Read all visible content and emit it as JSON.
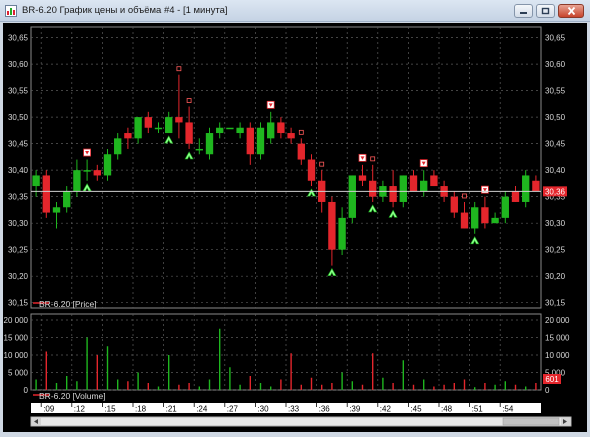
{
  "window": {
    "title": "BR-6.20 График цены и объёма #4 - [1 минута]",
    "minimize_icon": "minimize-icon",
    "maximize_icon": "maximize-icon",
    "close_icon": "close-icon"
  },
  "colors": {
    "background": "#000000",
    "bull": "#1fb61f",
    "bear": "#e4262c",
    "grid": "#5a5a5a",
    "axis_text": "#d8d8d8",
    "current_price_line": "#d0d0d0",
    "current_price_badge": "#e4262c"
  },
  "chart_data": [
    {
      "type": "candlestick",
      "legend": "BR-6.20 [Price]",
      "ylim": [
        30.14,
        30.67
      ],
      "y_ticks": [
        "30,15",
        "30,20",
        "30,25",
        "30,30",
        "30,35",
        "30,40",
        "30,45",
        "30,50",
        "30,55",
        "30,60",
        "30,65"
      ],
      "current_price_label": "30,36",
      "current_price": 30.36,
      "grid": "dashed",
      "candles": [
        {
          "o": 30.37,
          "h": 30.4,
          "l": 30.35,
          "c": 30.39
        },
        {
          "o": 30.39,
          "h": 30.4,
          "l": 30.31,
          "c": 30.32
        },
        {
          "o": 30.32,
          "h": 30.34,
          "l": 30.29,
          "c": 30.33
        },
        {
          "o": 30.33,
          "h": 30.37,
          "l": 30.32,
          "c": 30.36
        },
        {
          "o": 30.36,
          "h": 30.42,
          "l": 30.35,
          "c": 30.4
        },
        {
          "o": 30.4,
          "h": 30.42,
          "l": 30.38,
          "c": 30.4
        },
        {
          "o": 30.4,
          "h": 30.41,
          "l": 30.38,
          "c": 30.39
        },
        {
          "o": 30.39,
          "h": 30.44,
          "l": 30.38,
          "c": 30.43
        },
        {
          "o": 30.43,
          "h": 30.47,
          "l": 30.42,
          "c": 30.46
        },
        {
          "o": 30.47,
          "h": 30.48,
          "l": 30.44,
          "c": 30.46
        },
        {
          "o": 30.46,
          "h": 30.5,
          "l": 30.45,
          "c": 30.5
        },
        {
          "o": 30.5,
          "h": 30.51,
          "l": 30.47,
          "c": 30.48
        },
        {
          "o": 30.48,
          "h": 30.49,
          "l": 30.47,
          "c": 30.48
        },
        {
          "o": 30.47,
          "h": 30.51,
          "l": 30.47,
          "c": 30.5
        },
        {
          "o": 30.5,
          "h": 30.58,
          "l": 30.46,
          "c": 30.49
        },
        {
          "o": 30.49,
          "h": 30.52,
          "l": 30.44,
          "c": 30.45
        },
        {
          "o": 30.44,
          "h": 30.46,
          "l": 30.43,
          "c": 30.44
        },
        {
          "o": 30.43,
          "h": 30.48,
          "l": 30.42,
          "c": 30.47
        },
        {
          "o": 30.47,
          "h": 30.49,
          "l": 30.46,
          "c": 30.48
        },
        {
          "o": 30.48,
          "h": 30.48,
          "l": 30.48,
          "c": 30.48
        },
        {
          "o": 30.47,
          "h": 30.49,
          "l": 30.46,
          "c": 30.48
        },
        {
          "o": 30.48,
          "h": 30.49,
          "l": 30.41,
          "c": 30.43
        },
        {
          "o": 30.43,
          "h": 30.49,
          "l": 30.42,
          "c": 30.48
        },
        {
          "o": 30.46,
          "h": 30.51,
          "l": 30.45,
          "c": 30.49
        },
        {
          "o": 30.49,
          "h": 30.5,
          "l": 30.46,
          "c": 30.47
        },
        {
          "o": 30.47,
          "h": 30.48,
          "l": 30.45,
          "c": 30.46
        },
        {
          "o": 30.45,
          "h": 30.46,
          "l": 30.41,
          "c": 30.42
        },
        {
          "o": 30.42,
          "h": 30.43,
          "l": 30.37,
          "c": 30.38
        },
        {
          "o": 30.38,
          "h": 30.4,
          "l": 30.32,
          "c": 30.34
        },
        {
          "o": 30.34,
          "h": 30.35,
          "l": 30.22,
          "c": 30.25
        },
        {
          "o": 30.25,
          "h": 30.33,
          "l": 30.24,
          "c": 30.31
        },
        {
          "o": 30.31,
          "h": 30.39,
          "l": 30.3,
          "c": 30.39
        },
        {
          "o": 30.39,
          "h": 30.41,
          "l": 30.37,
          "c": 30.38
        },
        {
          "o": 30.38,
          "h": 30.41,
          "l": 30.34,
          "c": 30.35
        },
        {
          "o": 30.35,
          "h": 30.38,
          "l": 30.34,
          "c": 30.37
        },
        {
          "o": 30.37,
          "h": 30.4,
          "l": 30.33,
          "c": 30.34
        },
        {
          "o": 30.34,
          "h": 30.39,
          "l": 30.33,
          "c": 30.39
        },
        {
          "o": 30.39,
          "h": 30.4,
          "l": 30.36,
          "c": 30.36
        },
        {
          "o": 30.36,
          "h": 30.4,
          "l": 30.35,
          "c": 30.38
        },
        {
          "o": 30.39,
          "h": 30.4,
          "l": 30.37,
          "c": 30.37
        },
        {
          "o": 30.37,
          "h": 30.38,
          "l": 30.34,
          "c": 30.35
        },
        {
          "o": 30.35,
          "h": 30.36,
          "l": 30.31,
          "c": 30.32
        },
        {
          "o": 30.32,
          "h": 30.34,
          "l": 30.29,
          "c": 30.29
        },
        {
          "o": 30.29,
          "h": 30.34,
          "l": 30.28,
          "c": 30.33
        },
        {
          "o": 30.33,
          "h": 30.35,
          "l": 30.29,
          "c": 30.3
        },
        {
          "o": 30.3,
          "h": 30.32,
          "l": 30.3,
          "c": 30.31
        },
        {
          "o": 30.31,
          "h": 30.36,
          "l": 30.3,
          "c": 30.35
        },
        {
          "o": 30.36,
          "h": 30.37,
          "l": 30.34,
          "c": 30.34
        },
        {
          "o": 30.34,
          "h": 30.4,
          "l": 30.33,
          "c": 30.39
        },
        {
          "o": 30.38,
          "h": 30.39,
          "l": 30.36,
          "c": 30.36
        }
      ],
      "marker_bars": [
        {
          "bar": 5,
          "kind": "down"
        },
        {
          "bar": 5,
          "kind": "up"
        },
        {
          "bar": 14,
          "kind": "dot"
        },
        {
          "bar": 15,
          "kind": "dot"
        },
        {
          "bar": 13,
          "kind": "up"
        },
        {
          "bar": 15,
          "kind": "up"
        },
        {
          "bar": 23,
          "kind": "down"
        },
        {
          "bar": 26,
          "kind": "dot"
        },
        {
          "bar": 27,
          "kind": "up"
        },
        {
          "bar": 28,
          "kind": "dot"
        },
        {
          "bar": 29,
          "kind": "up"
        },
        {
          "bar": 32,
          "kind": "down"
        },
        {
          "bar": 33,
          "kind": "dot"
        },
        {
          "bar": 33,
          "kind": "up"
        },
        {
          "bar": 35,
          "kind": "up"
        },
        {
          "bar": 38,
          "kind": "down"
        },
        {
          "bar": 42,
          "kind": "dot"
        },
        {
          "bar": 43,
          "kind": "up"
        },
        {
          "bar": 44,
          "kind": "down"
        }
      ]
    },
    {
      "type": "bar",
      "legend": "BR-6.20 [Volume]",
      "ylim": [
        0,
        20000
      ],
      "y_ticks": [
        "20 000",
        "15 000",
        "10 000",
        "5 000",
        "0"
      ],
      "right_y_ticks": [
        "20 000",
        "15 000",
        "10 000",
        "5 000",
        "0"
      ],
      "last_value_label": "601",
      "values": [
        3000,
        11000,
        2000,
        4000,
        2500,
        15000,
        10000,
        12500,
        3000,
        2500,
        5000,
        2000,
        1000,
        10000,
        1500,
        2000,
        1000,
        3000,
        17500,
        6500,
        1500,
        4000,
        2000,
        1000,
        3000,
        10500,
        1500,
        3500,
        1500,
        2000,
        5000,
        2500,
        1500,
        10500,
        3500,
        2000,
        8500,
        1500,
        3000,
        1000,
        1500,
        2000,
        3000,
        800,
        2000,
        1500,
        2500,
        1500,
        1000,
        2000
      ],
      "x_tick_labels": [
        ":09",
        ":12",
        ":15",
        ":18",
        ":21",
        ":24",
        ":27",
        ":30",
        ":33",
        ":36",
        ":39",
        ":42",
        ":45",
        ":48",
        ":51",
        ":54"
      ]
    }
  ]
}
